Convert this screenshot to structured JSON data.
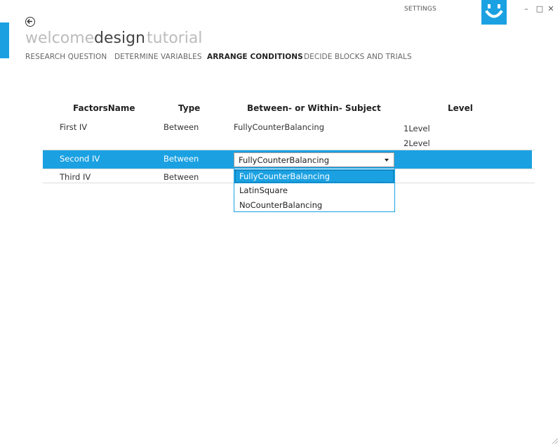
{
  "window": {
    "settings_label": "SETTINGS",
    "minimize_glyph": "–",
    "maximize_glyph": "□",
    "close_glyph": "✕",
    "smiley_icon": "smiley-icon",
    "accent_color": "#1ba1e2"
  },
  "pivot": {
    "items": [
      {
        "label": "welcome",
        "active": false
      },
      {
        "label": "design",
        "active": true
      },
      {
        "label": "tutorial",
        "active": false
      }
    ]
  },
  "subnav": {
    "items": [
      {
        "label": "RESEARCH QUESTION",
        "active": false
      },
      {
        "label": "DETERMINE VARIABLES",
        "active": false
      },
      {
        "label": "ARRANGE CONDITIONS",
        "active": true
      },
      {
        "label": "DECIDE BLOCKS AND TRIALS",
        "active": false
      }
    ]
  },
  "table": {
    "columns": [
      "FactorsName",
      "Type",
      "Between- or Within- Subject",
      "Level"
    ],
    "rows": [
      {
        "name": "First IV",
        "type": "Between",
        "subject": "FullyCounterBalancing",
        "levels": [
          "1Level",
          "2Level"
        ]
      },
      {
        "name": "Second IV",
        "type": "Between",
        "subject": "FullyCounterBalancing",
        "levels": []
      },
      {
        "name": "Third IV",
        "type": "Between",
        "subject": "",
        "levels": []
      }
    ]
  },
  "combo": {
    "value": "FullyCounterBalancing",
    "options": [
      "FullyCounterBalancing",
      "LatinSquare",
      "NoCounterBalancing"
    ],
    "highlighted_option": "FullyCounterBalancing"
  }
}
